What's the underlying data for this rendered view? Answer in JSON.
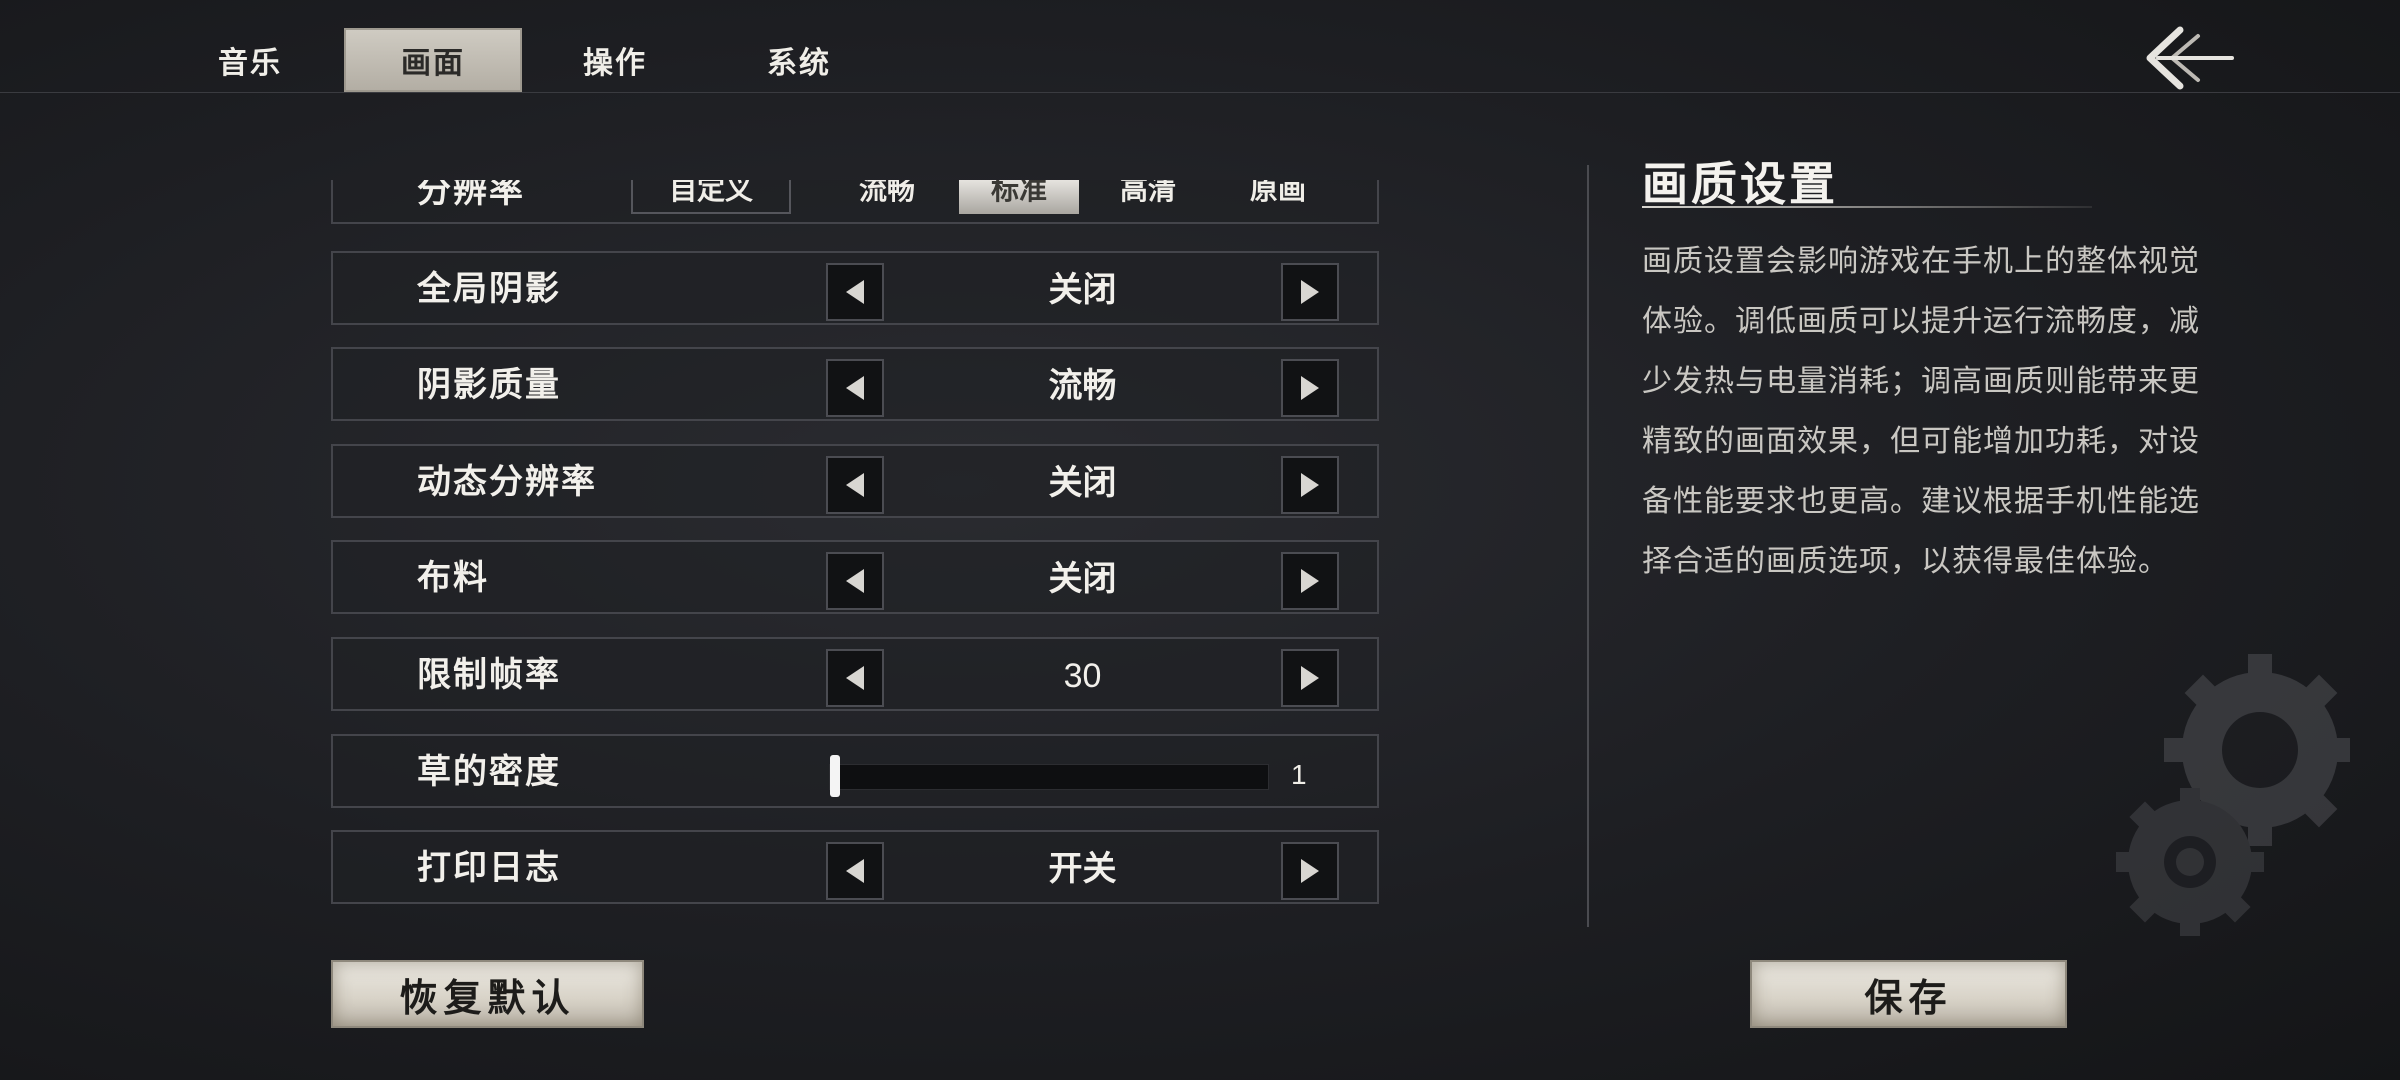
{
  "tabs": [
    {
      "label": "音乐",
      "active": false
    },
    {
      "label": "画面",
      "active": true
    },
    {
      "label": "操作",
      "active": false
    },
    {
      "label": "系统",
      "active": false
    }
  ],
  "resolution": {
    "label": "分辨率",
    "options": [
      "自定义",
      "流畅",
      "标准",
      "高清",
      "原画"
    ],
    "selected": "标准"
  },
  "settings": [
    {
      "label": "全局阴影",
      "value": "关闭"
    },
    {
      "label": "阴影质量",
      "value": "流畅"
    },
    {
      "label": "动态分辨率",
      "value": "关闭"
    },
    {
      "label": "布料",
      "value": "关闭"
    },
    {
      "label": "限制帧率",
      "value": "30"
    }
  ],
  "grass": {
    "label": "草的密度",
    "value": "1",
    "level_fraction": 0.0
  },
  "log": {
    "label": "打印日志",
    "value": "开关"
  },
  "info": {
    "title": "画质设置",
    "body": "画质设置会影响游戏在手机上的整体视觉体验。调低画质可以提升运行流畅度，减少发热与电量消耗；调高画质则能带来更精致的画面效果，但可能增加功耗，对设备性能要求也更高。建议根据手机性能选择合适的画质选项，以获得最佳体验。"
  },
  "buttons": {
    "reset": "恢复默认",
    "save": "保存"
  },
  "icons": {
    "back": "back-arrow-icon",
    "prev": "triangle-left-icon",
    "next": "triangle-right-icon",
    "decor": "gear-icon"
  },
  "colors": {
    "accent_selected": "#cfcbc2",
    "background": "#1d1e22",
    "row_border": "#44454b"
  }
}
